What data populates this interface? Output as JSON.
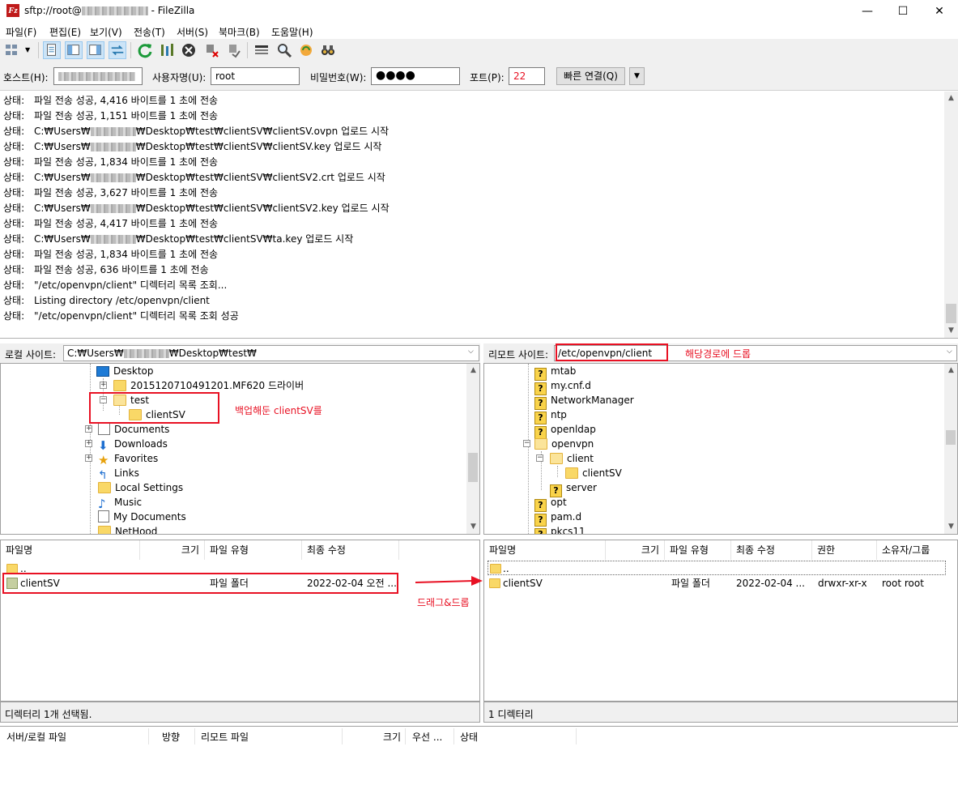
{
  "window": {
    "title_prefix": "sftp://root@",
    "title_suffix": " - FileZilla",
    "minimize": "—",
    "maximize": "☐",
    "close": "✕"
  },
  "menu": [
    "파일(F)",
    "편집(E)",
    "보기(V)",
    "전송(T)",
    "서버(S)",
    "북마크(B)",
    "도움말(H)"
  ],
  "quickconnect": {
    "host_label": "호스트(H):",
    "user_label": "사용자명(U):",
    "user_value": "root",
    "pass_label": "비밀번호(W):",
    "pass_value": "●●●●",
    "port_label": "포트(P):",
    "port_value": "22",
    "connect_button": "빠른 연결(Q)"
  },
  "log": [
    {
      "tag": "상태:",
      "text": "파일 전송 성공, 4,416 바이트를 1 초에 전송"
    },
    {
      "tag": "상태:",
      "text": "파일 전송 성공, 1,151 바이트를 1 초에 전송"
    },
    {
      "tag": "상태:",
      "pre": "C:₩Users₩",
      "post": "₩Desktop₩test₩clientSV₩clientSV.ovpn 업로드 시작"
    },
    {
      "tag": "상태:",
      "pre": "C:₩Users₩",
      "post": "₩Desktop₩test₩clientSV₩clientSV.key 업로드 시작"
    },
    {
      "tag": "상태:",
      "text": "파일 전송 성공, 1,834 바이트를 1 초에 전송"
    },
    {
      "tag": "상태:",
      "pre": "C:₩Users₩",
      "post": "₩Desktop₩test₩clientSV₩clientSV2.crt 업로드 시작"
    },
    {
      "tag": "상태:",
      "text": "파일 전송 성공, 3,627 바이트를 1 초에 전송"
    },
    {
      "tag": "상태:",
      "pre": "C:₩Users₩",
      "post": "₩Desktop₩test₩clientSV₩clientSV2.key 업로드 시작"
    },
    {
      "tag": "상태:",
      "text": "파일 전송 성공, 4,417 바이트를 1 초에 전송"
    },
    {
      "tag": "상태:",
      "pre": "C:₩Users₩",
      "post": "₩Desktop₩test₩clientSV₩ta.key 업로드 시작"
    },
    {
      "tag": "상태:",
      "text": "파일 전송 성공, 1,834 바이트를 1 초에 전송"
    },
    {
      "tag": "상태:",
      "text": "파일 전송 성공, 636 바이트를 1 초에 전송"
    },
    {
      "tag": "상태:",
      "text": "\"/etc/openvpn/client\" 디렉터리 목록 조회..."
    },
    {
      "tag": "상태:",
      "text": "Listing directory /etc/openvpn/client"
    },
    {
      "tag": "상태:",
      "text": "\"/etc/openvpn/client\" 디렉터리 목록 조회 성공"
    }
  ],
  "local": {
    "site_label": "로컬 사이트:",
    "path_pre": "C:₩Users₩",
    "path_post": "₩Desktop₩test₩",
    "tree": [
      "Desktop",
      "2015120710491201.MF620 드라이버",
      "test",
      "clientSV",
      "Documents",
      "Downloads",
      "Favorites",
      "Links",
      "Local Settings",
      "Music",
      "My Documents",
      "NetHood"
    ],
    "columns": [
      "파일명",
      "크기",
      "파일 유형",
      "최종 수정"
    ],
    "files": [
      {
        "name": "..",
        "size": "",
        "type": "",
        "modified": ""
      },
      {
        "name": "clientSV",
        "size": "",
        "type": "파일 폴더",
        "modified": "2022-02-04 오전 ..."
      }
    ],
    "status": "디렉터리 1개 선택됨."
  },
  "remote": {
    "site_label": "리모트 사이트:",
    "path": "/etc/openvpn/client",
    "tree": [
      "mtab",
      "my.cnf.d",
      "NetworkManager",
      "ntp",
      "openldap",
      "openvpn",
      "client",
      "clientSV",
      "server",
      "opt",
      "pam.d",
      "pkcs11"
    ],
    "columns": [
      "파일명",
      "크기",
      "파일 유형",
      "최종 수정",
      "권한",
      "소유자/그룹"
    ],
    "files": [
      {
        "name": "..",
        "size": "",
        "type": "",
        "modified": "",
        "perm": "",
        "owner": ""
      },
      {
        "name": "clientSV",
        "size": "",
        "type": "파일 폴더",
        "modified": "2022-02-04 ...",
        "perm": "drwxr-xr-x",
        "owner": "root root"
      }
    ],
    "status": "1 디렉터리"
  },
  "queue": {
    "columns": [
      "서버/로컬 파일",
      "방향",
      "리모트 파일",
      "크기",
      "우선 ...",
      "상태"
    ]
  },
  "annotations": {
    "backup": "백업해둔 clientSV를",
    "target": "해당경로에 드롭",
    "dragdrop": "드래그&드롭",
    "color": "#e81123"
  }
}
